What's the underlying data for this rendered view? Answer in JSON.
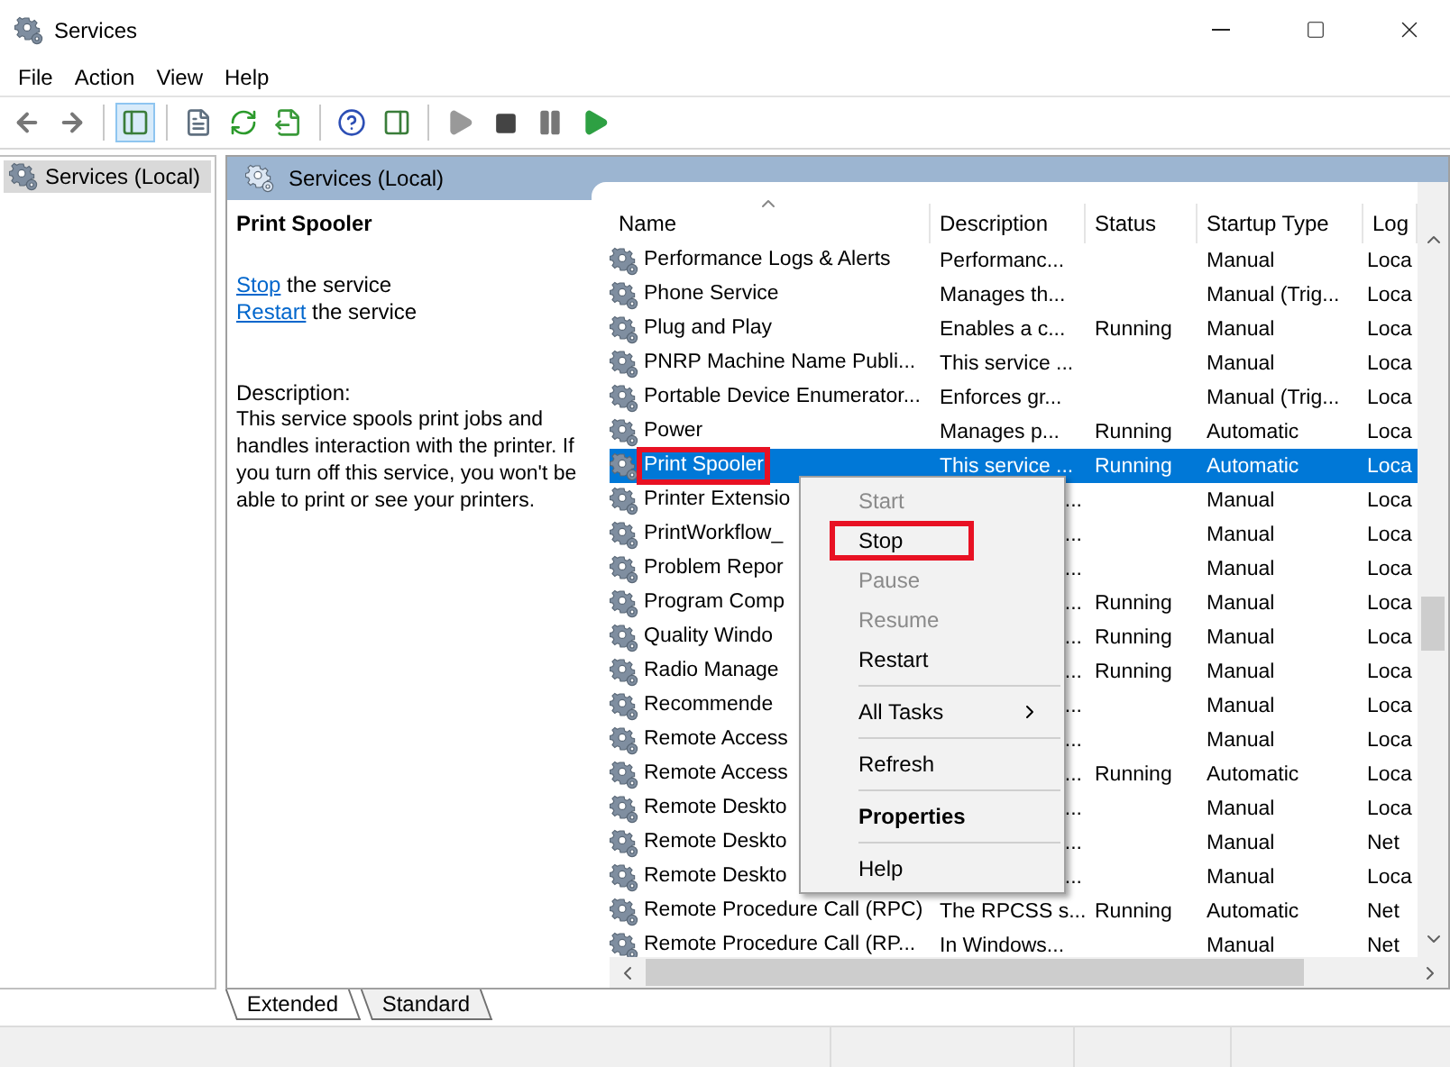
{
  "window": {
    "title": "Services"
  },
  "menu_bar": [
    "File",
    "Action",
    "View",
    "Help"
  ],
  "toolbar": [
    {
      "kind": "back",
      "selected": false
    },
    {
      "kind": "forward",
      "selected": false
    },
    {
      "kind": "sep"
    },
    {
      "kind": "tree",
      "selected": true
    },
    {
      "kind": "sep"
    },
    {
      "kind": "properties",
      "selected": false
    },
    {
      "kind": "refresh",
      "selected": false
    },
    {
      "kind": "export",
      "selected": false
    },
    {
      "kind": "sep"
    },
    {
      "kind": "help",
      "selected": false
    },
    {
      "kind": "pane",
      "selected": false
    },
    {
      "kind": "sep"
    },
    {
      "kind": "start",
      "selected": false
    },
    {
      "kind": "stop",
      "selected": false
    },
    {
      "kind": "pause",
      "selected": false
    },
    {
      "kind": "resume",
      "selected": false
    }
  ],
  "tree": {
    "items": [
      {
        "label": "Services (Local)",
        "selected": true
      }
    ]
  },
  "pane": {
    "title": "Services (Local)",
    "details": {
      "heading": "Print Spooler",
      "actions": [
        {
          "link": "Stop",
          "text": "the service"
        },
        {
          "link": "Restart",
          "text": "the service"
        }
      ],
      "description_label": "Description:",
      "description": "This service spools print jobs and handles interaction with the printer. If you turn off this service, you won't be able to print or see your printers."
    },
    "table": {
      "columns": [
        "Name",
        "Description",
        "Status",
        "Startup Type",
        "Log"
      ],
      "rows": [
        {
          "name": "Performance Logs & Alerts",
          "description": "Performanc...",
          "status": "",
          "startup": "Manual",
          "log": "Loca",
          "selected": false,
          "highlighted": false,
          "kind": "normal"
        },
        {
          "name": "Phone Service",
          "description": "Manages th...",
          "status": "",
          "startup": "Manual (Trig...",
          "log": "Loca",
          "selected": false,
          "highlighted": false,
          "kind": "normal"
        },
        {
          "name": "Plug and Play",
          "description": "Enables a c...",
          "status": "Running",
          "startup": "Manual",
          "log": "Loca",
          "selected": false,
          "highlighted": false,
          "kind": "normal"
        },
        {
          "name": "PNRP Machine Name Publi...",
          "description": "This service ...",
          "status": "",
          "startup": "Manual",
          "log": "Loca",
          "selected": false,
          "highlighted": false,
          "kind": "normal"
        },
        {
          "name": "Portable Device Enumerator...",
          "description": "Enforces gr...",
          "status": "",
          "startup": "Manual (Trig...",
          "log": "Loca",
          "selected": false,
          "highlighted": false,
          "kind": "normal"
        },
        {
          "name": "Power",
          "description": "Manages p...",
          "status": "Running",
          "startup": "Automatic",
          "log": "Loca",
          "selected": false,
          "highlighted": false,
          "kind": "normal"
        },
        {
          "name": "Print Spooler",
          "description": "This service ...",
          "status": "Running",
          "startup": "Automatic",
          "log": "Loca",
          "selected": true,
          "highlighted": true,
          "kind": "normal"
        },
        {
          "name": "Printer Extensio",
          "description": "...",
          "status": "",
          "startup": "Manual",
          "log": "Loca",
          "selected": false,
          "highlighted": false,
          "kind": "covered"
        },
        {
          "name": "PrintWorkflow_",
          "description": "...",
          "status": "",
          "startup": "Manual",
          "log": "Loca",
          "selected": false,
          "highlighted": false,
          "kind": "covered"
        },
        {
          "name": "Problem Repor",
          "description": "...",
          "status": "",
          "startup": "Manual",
          "log": "Loca",
          "selected": false,
          "highlighted": false,
          "kind": "covered"
        },
        {
          "name": "Program Comp",
          "description": "...",
          "status": "Running",
          "startup": "Manual",
          "log": "Loca",
          "selected": false,
          "highlighted": false,
          "kind": "covered"
        },
        {
          "name": "Quality Windo",
          "description": "...",
          "status": "Running",
          "startup": "Manual",
          "log": "Loca",
          "selected": false,
          "highlighted": false,
          "kind": "covered"
        },
        {
          "name": "Radio Manage",
          "description": "...",
          "status": "Running",
          "startup": "Manual",
          "log": "Loca",
          "selected": false,
          "highlighted": false,
          "kind": "covered"
        },
        {
          "name": "Recommende",
          "description": "...",
          "status": "",
          "startup": "Manual",
          "log": "Loca",
          "selected": false,
          "highlighted": false,
          "kind": "covered"
        },
        {
          "name": "Remote Access",
          "description": "...",
          "status": "",
          "startup": "Manual",
          "log": "Loca",
          "selected": false,
          "highlighted": false,
          "kind": "covered"
        },
        {
          "name": "Remote Access",
          "description": "...",
          "status": "Running",
          "startup": "Automatic",
          "log": "Loca",
          "selected": false,
          "highlighted": false,
          "kind": "covered"
        },
        {
          "name": "Remote Deskto",
          "description": "...",
          "status": "",
          "startup": "Manual",
          "log": "Loca",
          "selected": false,
          "highlighted": false,
          "kind": "covered"
        },
        {
          "name": "Remote Deskto",
          "description": "...",
          "status": "",
          "startup": "Manual",
          "log": "Net",
          "selected": false,
          "highlighted": false,
          "kind": "covered"
        },
        {
          "name": "Remote Deskto",
          "description": "...",
          "status": "",
          "startup": "Manual",
          "log": "Loca",
          "selected": false,
          "highlighted": false,
          "kind": "covered"
        },
        {
          "name": "Remote Procedure Call (RPC)",
          "description": "The RPCSS s...",
          "status": "Running",
          "startup": "Automatic",
          "log": "Net",
          "selected": false,
          "highlighted": false,
          "kind": "normal"
        },
        {
          "name": "Remote Procedure Call (RP...",
          "description": "In Windows...",
          "status": "",
          "startup": "Manual",
          "log": "Net",
          "selected": false,
          "highlighted": false,
          "kind": "normal"
        }
      ]
    }
  },
  "context_menu": [
    {
      "kind": "item",
      "label": "Start",
      "disabled": true,
      "bold": false,
      "highlighted": false
    },
    {
      "kind": "item",
      "label": "Stop",
      "disabled": false,
      "bold": false,
      "highlighted": true
    },
    {
      "kind": "item",
      "label": "Pause",
      "disabled": true,
      "bold": false,
      "highlighted": false
    },
    {
      "kind": "item",
      "label": "Resume",
      "disabled": true,
      "bold": false,
      "highlighted": false
    },
    {
      "kind": "item",
      "label": "Restart",
      "disabled": false,
      "bold": false,
      "highlighted": false
    },
    {
      "kind": "separator"
    },
    {
      "kind": "submenu",
      "label": "All Tasks",
      "disabled": false,
      "bold": false,
      "highlighted": false
    },
    {
      "kind": "separator"
    },
    {
      "kind": "item",
      "label": "Refresh",
      "disabled": false,
      "bold": false,
      "highlighted": false
    },
    {
      "kind": "separator"
    },
    {
      "kind": "item",
      "label": "Properties",
      "disabled": false,
      "bold": true,
      "highlighted": false
    },
    {
      "kind": "separator"
    },
    {
      "kind": "item",
      "label": "Help",
      "disabled": false,
      "bold": false,
      "highlighted": false
    }
  ],
  "bottom_tabs": [
    {
      "label": "Extended",
      "selected": true
    },
    {
      "label": "Standard",
      "selected": false
    }
  ]
}
